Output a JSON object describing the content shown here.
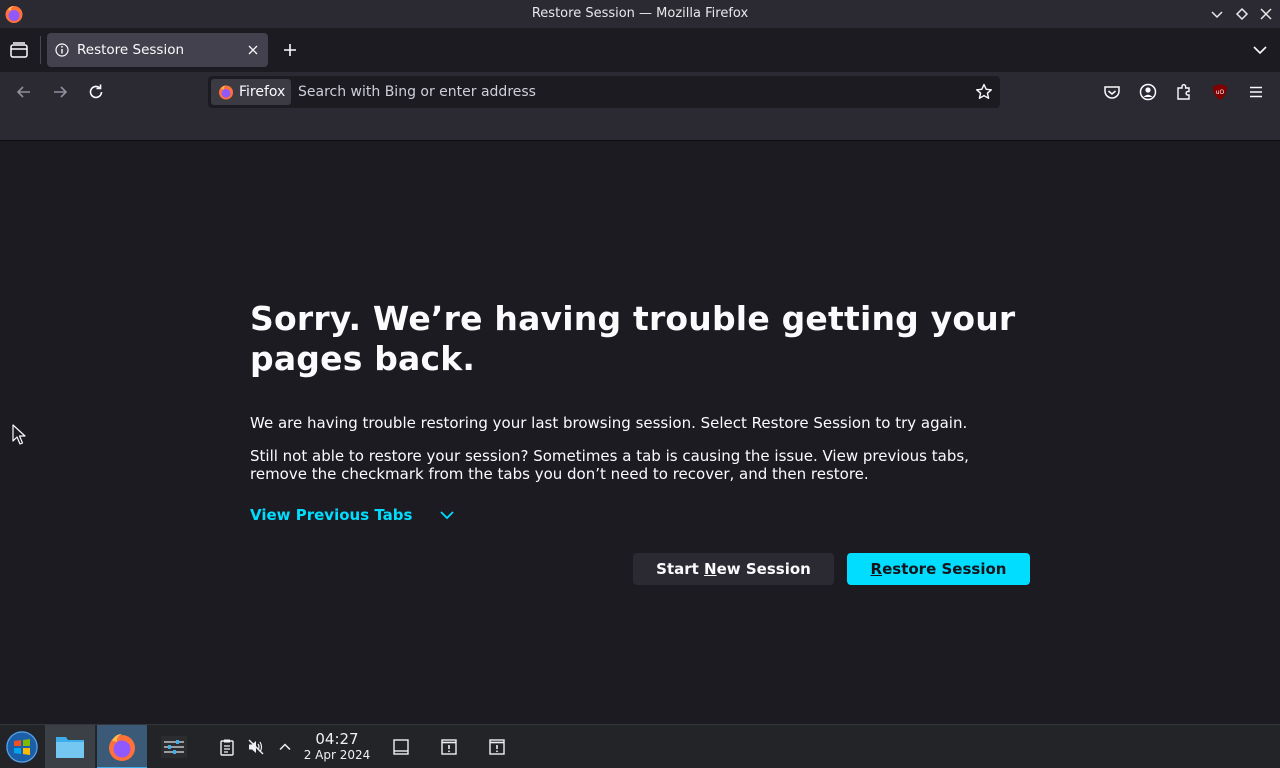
{
  "window": {
    "title": "Restore Session — Mozilla Firefox"
  },
  "tab": {
    "label": "Restore Session"
  },
  "urlbar": {
    "identity_label": "Firefox",
    "placeholder": "Search with Bing or enter address"
  },
  "page": {
    "heading": "Sorry. We’re having trouble getting your pages back.",
    "paragraph1": "We are having trouble restoring your last browsing session. Select Restore Session to try again.",
    "paragraph2": "Still not able to restore your session? Sometimes a tab is causing the issue. View previous tabs, remove the checkmark from the tabs you don’t need to recover, and then restore.",
    "view_previous_tabs": "View Previous Tabs",
    "start_new": {
      "accesskey": "N",
      "before": "Start ",
      "after": "ew Session"
    },
    "restore": {
      "accesskey": "R",
      "after": "estore Session"
    }
  },
  "taskbar": {
    "time": "04:27",
    "date": "2 Apr 2024"
  },
  "colors": {
    "accent": "#00ddff",
    "page_bg": "#1c1b22",
    "toolbar_bg": "#2b2a33",
    "ublock": "#800000"
  },
  "icons": [
    "firefox-icon",
    "chevron-down-icon",
    "restore-diamond-icon",
    "tabs-overview-icon",
    "info-icon",
    "close-icon",
    "plus-icon",
    "back-icon",
    "forward-icon",
    "reload-icon",
    "star-icon",
    "pocket-icon",
    "account-icon",
    "extensions-icon",
    "ublock-icon",
    "menu-icon",
    "start-icon",
    "file-manager-icon",
    "mixer-icon",
    "clipboard-icon",
    "volume-muted-icon",
    "chevron-up-icon",
    "show-desktop-icon",
    "notification-icon"
  ]
}
